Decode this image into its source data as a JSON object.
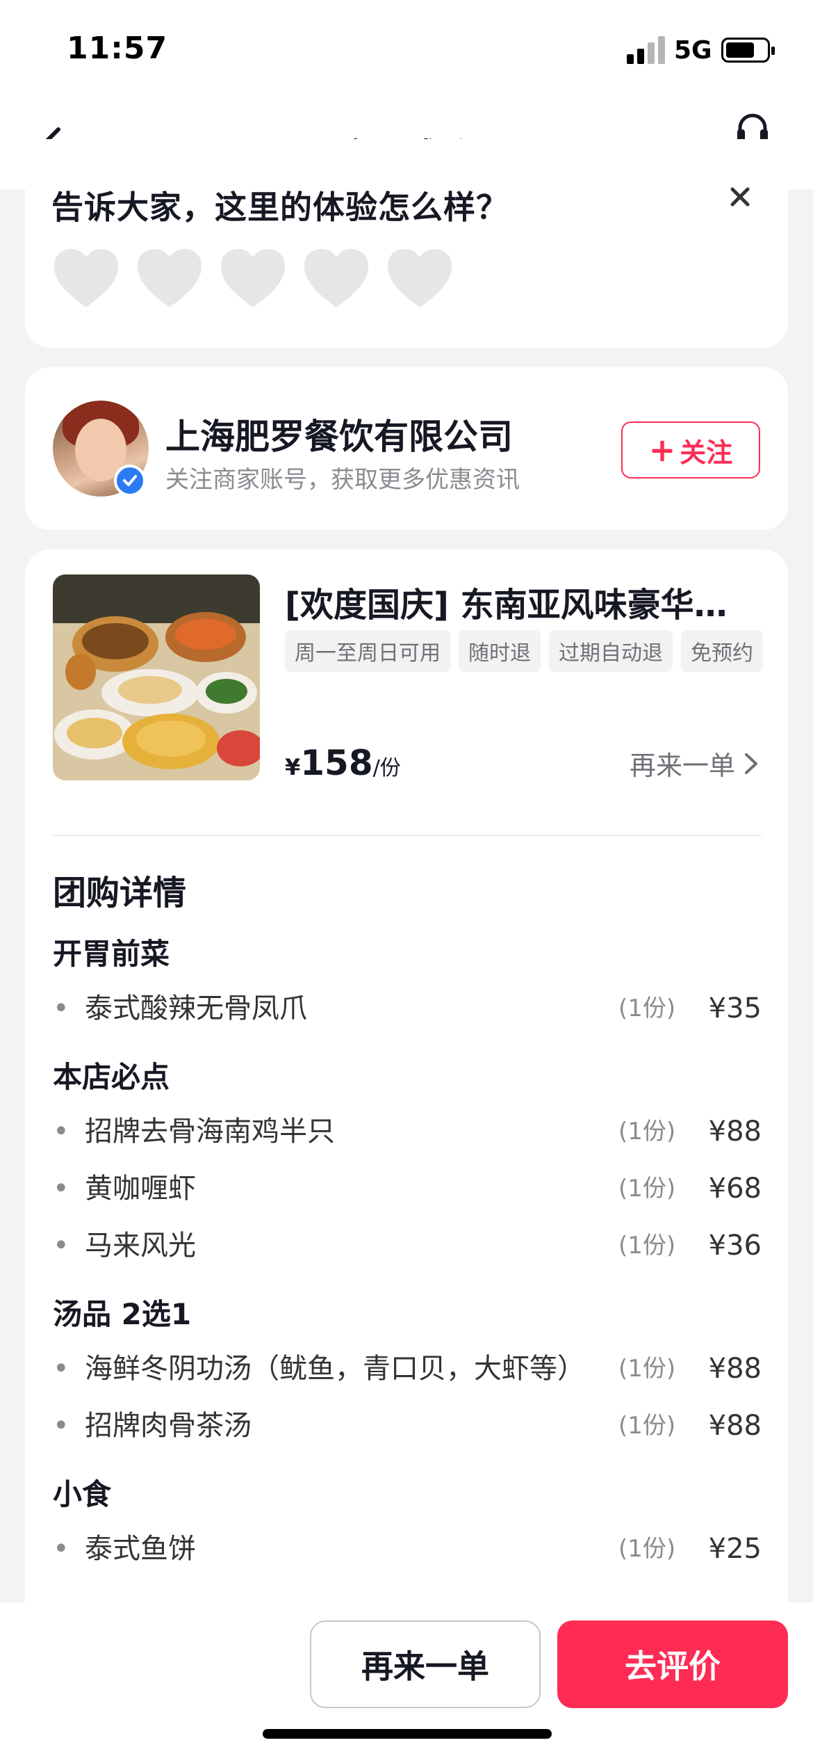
{
  "status_bar": {
    "time": "11:57",
    "network": "5G"
  },
  "nav": {
    "title": "交易成功",
    "service_label": "客服"
  },
  "rating": {
    "prompt": "告诉大家，这里的体验怎么样？",
    "hearts": 5,
    "filled": 0
  },
  "merchant": {
    "name": "上海肥罗餐饮有限公司",
    "subtitle": "关注商家账号，获取更多优惠资讯",
    "follow_label": "关注",
    "verified": true
  },
  "deal": {
    "title": "[欢度国庆] 东南亚风味豪华…",
    "tags": [
      "周一至周日可用",
      "随时退",
      "过期自动退",
      "免预约"
    ],
    "price_symbol": "¥",
    "price": "158",
    "price_unit": "/份",
    "reorder_link": "再来一单"
  },
  "details": {
    "title": "团购详情",
    "sections": [
      {
        "title": "开胃前菜",
        "items": [
          {
            "name": "泰式酸辣无骨凤爪",
            "qty": "(1份)",
            "price": "¥35"
          }
        ]
      },
      {
        "title": "本店必点",
        "items": [
          {
            "name": "招牌去骨海南鸡半只",
            "qty": "(1份)",
            "price": "¥88"
          },
          {
            "name": "黄咖喱虾",
            "qty": "(1份)",
            "price": "¥68"
          },
          {
            "name": "马来风光",
            "qty": "(1份)",
            "price": "¥36"
          }
        ]
      },
      {
        "title": "汤品 2选1",
        "items": [
          {
            "name": "海鲜冬阴功汤（鱿鱼，青口贝，大虾等）",
            "qty": "(1份)",
            "price": "¥88"
          },
          {
            "name": "招牌肉骨茶汤",
            "qty": "(1份)",
            "price": "¥88"
          }
        ]
      },
      {
        "title": "小食",
        "items": [
          {
            "name": "泰式鱼饼",
            "qty": "(1份)",
            "price": "¥25"
          }
        ]
      }
    ]
  },
  "bottom": {
    "reorder_label": "再来一单",
    "review_label": "去评价"
  },
  "colors": {
    "accent": "#fe2c55",
    "verify": "#2b7bf5",
    "heart_empty": "#e8e6e4"
  }
}
